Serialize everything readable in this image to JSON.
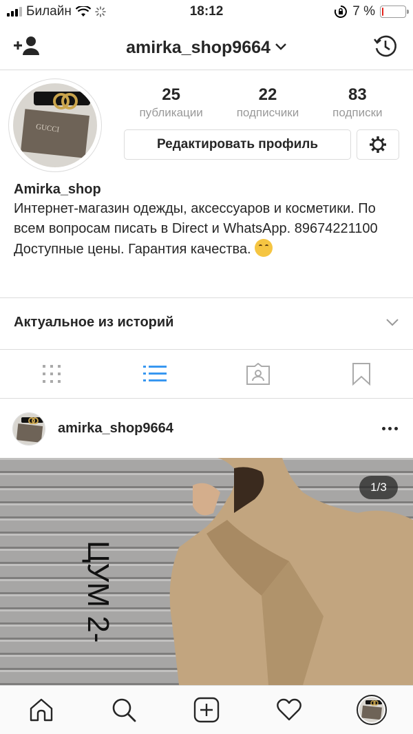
{
  "status_bar": {
    "carrier": "Билайн",
    "time": "18:12",
    "battery_percent": "7 %",
    "battery_level": 0.07,
    "battery_color": "#e5231b"
  },
  "nav": {
    "title": "amirka_shop9664",
    "left_icon": "add-person-icon",
    "right_icon": "history-icon"
  },
  "profile": {
    "stats": [
      {
        "count": "25",
        "label": "публикации"
      },
      {
        "count": "22",
        "label": "подписчики"
      },
      {
        "count": "83",
        "label": "подписки"
      }
    ],
    "edit_button": "Редактировать профиль",
    "settings_icon": "gear-icon",
    "name": "Amirka_shop",
    "bio": "Интернет-магазин одежды, аксессуаров и косметики. По всем вопросам писать в Direct и WhatsApp. 89674221100 Доступные цены. Гарантия качества."
  },
  "highlights": {
    "label": "Актуальное из историй"
  },
  "tabs": [
    {
      "icon": "grid-icon",
      "active": false
    },
    {
      "icon": "list-icon",
      "active": true
    },
    {
      "icon": "tagged-icon",
      "active": false
    },
    {
      "icon": "bookmark-icon",
      "active": false
    }
  ],
  "post": {
    "username": "amirka_shop9664",
    "counter": "1/3",
    "overlay_text": "ЦУМ 2-"
  },
  "tab_bar": [
    {
      "icon": "home-icon"
    },
    {
      "icon": "search-icon"
    },
    {
      "icon": "new-post-icon"
    },
    {
      "icon": "heart-icon"
    },
    {
      "icon": "profile-avatar"
    }
  ],
  "colors": {
    "text": "#262626",
    "muted": "#999999",
    "border": "#dbdbdb",
    "active_tab": "#3897f0"
  }
}
